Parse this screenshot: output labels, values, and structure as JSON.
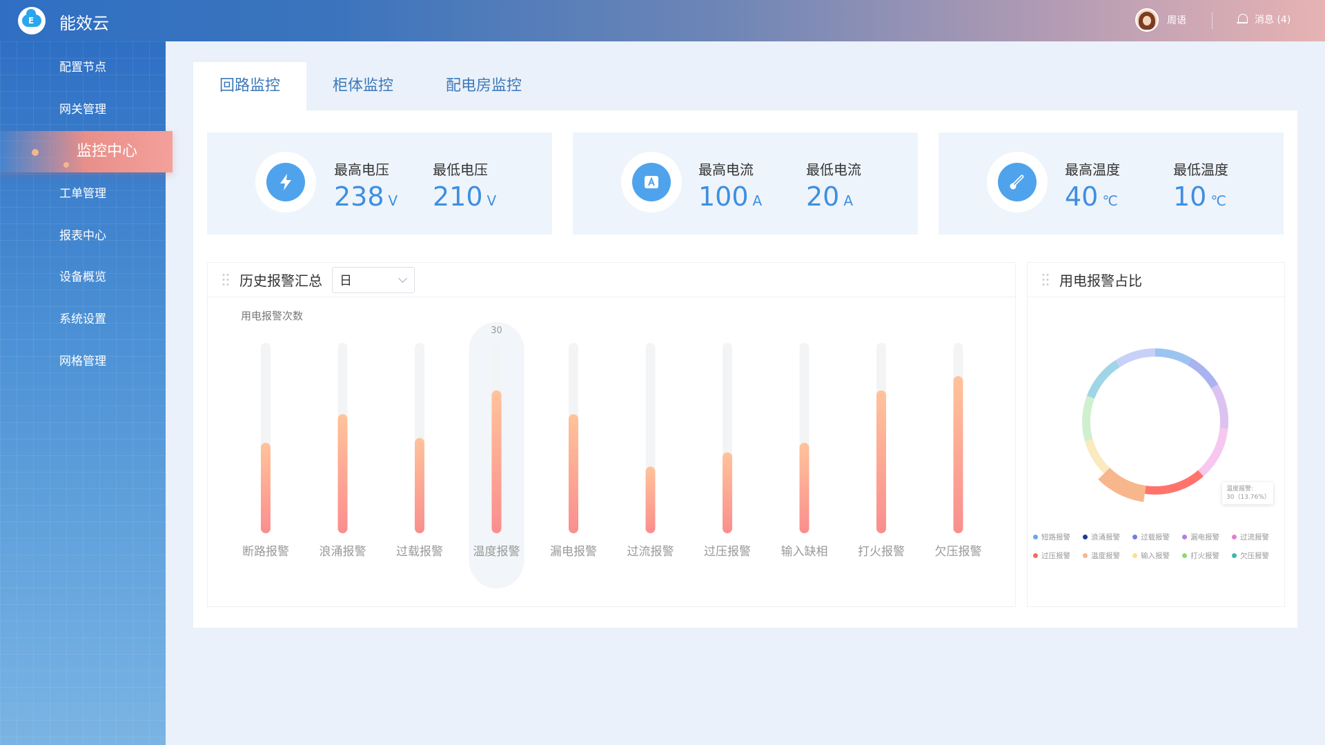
{
  "app": {
    "title": "能效云"
  },
  "header": {
    "user_name": "周语",
    "messages_label": "消息 (4)"
  },
  "sidebar": {
    "items": [
      {
        "label": "配置节点"
      },
      {
        "label": "网关管理"
      },
      {
        "label": "监控中心",
        "active": true
      },
      {
        "label": "工单管理"
      },
      {
        "label": "报表中心"
      },
      {
        "label": "设备概览"
      },
      {
        "label": "系统设置"
      },
      {
        "label": "网格管理"
      }
    ]
  },
  "tabs": [
    {
      "label": "回路监控",
      "active": true
    },
    {
      "label": "柜体监控"
    },
    {
      "label": "配电房监控"
    }
  ],
  "stats": [
    {
      "icon": "lightning-icon",
      "items": [
        {
          "label": "最高电压",
          "value": "238",
          "unit": "V"
        },
        {
          "label": "最低电压",
          "value": "210",
          "unit": "V"
        }
      ]
    },
    {
      "icon": "ampere-icon",
      "items": [
        {
          "label": "最高电流",
          "value": "100",
          "unit": "A"
        },
        {
          "label": "最低电流",
          "value": "20",
          "unit": "A"
        }
      ]
    },
    {
      "icon": "thermometer-icon",
      "items": [
        {
          "label": "最高温度",
          "value": "40",
          "unit": "℃"
        },
        {
          "label": "最低温度",
          "value": "10",
          "unit": "℃"
        }
      ]
    }
  ],
  "history": {
    "title": "历史报警汇总",
    "period": "日"
  },
  "pie_panel": {
    "title": "用电报警占比"
  },
  "colors": {
    "accent": "#3e8fe0",
    "bar_top": "#ffc39a",
    "bar_bottom": "#fa8e8e",
    "active_nav": "#ef9590"
  },
  "chart_data": [
    {
      "type": "bar",
      "ylabel": "用电报警次数",
      "categories": [
        "断路报警",
        "浪涌报警",
        "过载报警",
        "温度报警",
        "漏电报警",
        "过流报警",
        "过压报警",
        "输入缺相",
        "打火报警",
        "欠压报警"
      ],
      "values": [
        19,
        25,
        20,
        30,
        25,
        14,
        17,
        19,
        30,
        33
      ],
      "ylim": [
        0,
        40
      ],
      "highlighted": {
        "category": "温度报警",
        "label": "30"
      },
      "grid": false
    },
    {
      "type": "pie",
      "variant": "donut",
      "labels": [
        "短路报警",
        "浪涌报警",
        "过载报警",
        "漏电报警",
        "过流报警",
        "过压报警",
        "温度报警",
        "输入报警",
        "打火报警",
        "欠压报警"
      ],
      "values": [
        18,
        20,
        18,
        22,
        26,
        30,
        22,
        18,
        22,
        22
      ],
      "colors": [
        "#6aa6ee",
        "#1f3a93",
        "#6f7fe0",
        "#b77ed8",
        "#e07fd0",
        "#f36b63",
        "#f8b68d",
        "#fbe08a",
        "#8ed870",
        "#3ab9b4"
      ],
      "highlighted": {
        "label": "温度报警:",
        "value_text": "30（13.76%）"
      },
      "legend": "bottom"
    }
  ]
}
